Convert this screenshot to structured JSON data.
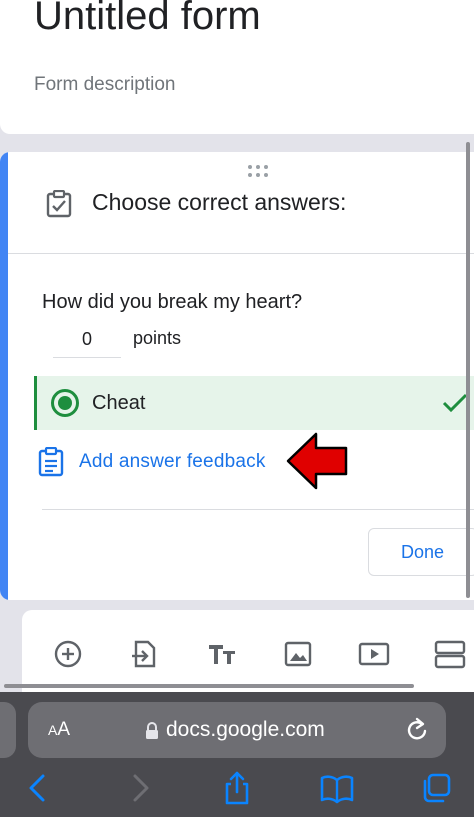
{
  "form": {
    "title": "Untitled form",
    "description": "Form description"
  },
  "question": {
    "header_title": "Choose correct answers:",
    "text": "How did you break my heart?",
    "points_value": "0",
    "points_label": "points",
    "answer": "Cheat",
    "feedback_link": "Add answer feedback",
    "done_label": "Done"
  },
  "toolbar": {
    "icons": [
      "add-question-icon",
      "import-questions-icon",
      "add-title-icon",
      "add-image-icon",
      "add-video-icon",
      "add-section-icon"
    ]
  },
  "browser": {
    "aa_label_big": "A",
    "aa_label_small": "A",
    "url": "docs.google.com"
  },
  "colors": {
    "accent_blue": "#4285f4",
    "link_blue": "#1a73e8",
    "correct_green": "#1e8e3e",
    "correct_bg": "#e6f4ea",
    "annotation_red": "#e00000"
  }
}
